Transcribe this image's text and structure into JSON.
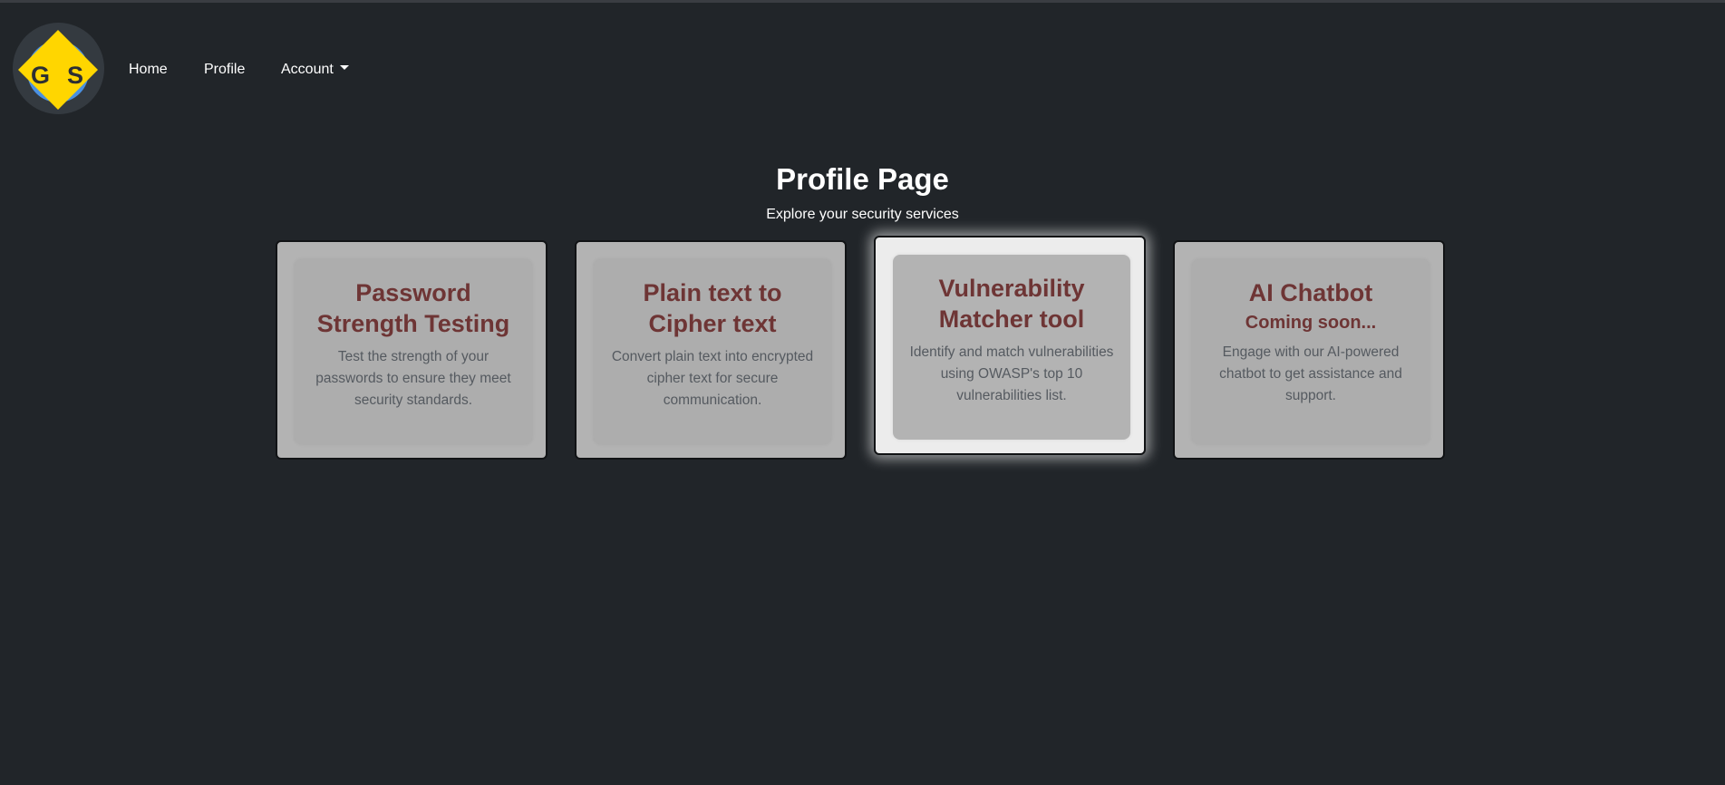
{
  "brand": {
    "letters": [
      "G",
      "S"
    ],
    "colors": {
      "diamond": "#ffd600",
      "circle": "#4a90e2",
      "ring": "#343a40"
    }
  },
  "nav": {
    "home": "Home",
    "profile": "Profile",
    "account": "Account"
  },
  "page": {
    "title": "Profile Page",
    "subtitle": "Explore your security services"
  },
  "cards": [
    {
      "title": "Password Strength Testing",
      "subtitle": "",
      "text": "Test the strength of your passwords to ensure they meet security standards."
    },
    {
      "title": "Plain text to Cipher text",
      "subtitle": "",
      "text": "Convert plain text into encrypted cipher text for secure communication."
    },
    {
      "title": "Vulnerability Matcher tool",
      "subtitle": "",
      "text": "Identify and match vulnerabilities using OWASP's top 10 vulnerabilities list."
    },
    {
      "title": "AI Chatbot",
      "subtitle": "Coming soon...",
      "text": "Engage with our AI-powered chatbot to get assistance and support."
    }
  ],
  "colors": {
    "background": "#212529",
    "card_title": "#6e3535",
    "card_text": "#555a60",
    "card_bg": "#b3b3b3",
    "card_active_bg": "#ececec"
  }
}
